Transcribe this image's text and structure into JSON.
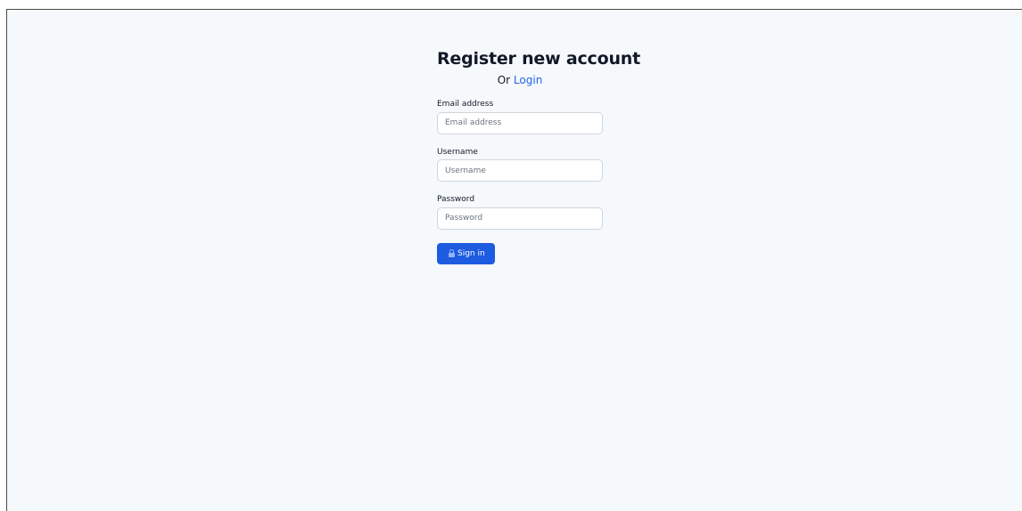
{
  "header": {
    "title": "Register new account",
    "subtitle_prefix": "Or",
    "login_link": "Login"
  },
  "form": {
    "email": {
      "label": "Email address",
      "placeholder": "Email address",
      "value": ""
    },
    "username": {
      "label": "Username",
      "placeholder": "Username",
      "value": ""
    },
    "password": {
      "label": "Password",
      "placeholder": "Password",
      "value": ""
    },
    "submit": {
      "label": "Sign in",
      "icon": "lock-icon"
    }
  },
  "colors": {
    "background": "#f6f9fc",
    "link": "#2563eb",
    "button": "#1d5be0"
  }
}
